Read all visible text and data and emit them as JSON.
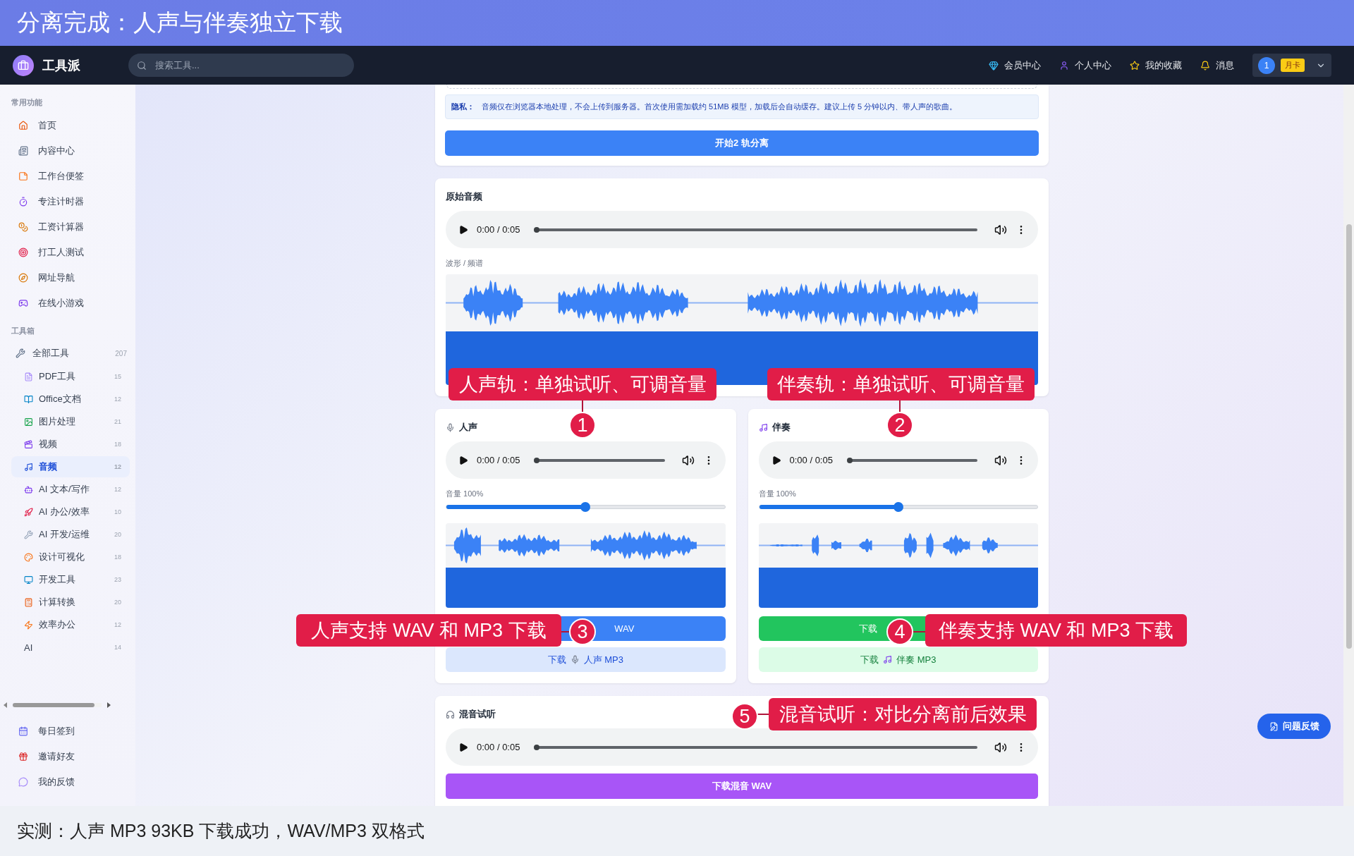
{
  "banner": {
    "title": "分离完成：人声与伴奏独立下载"
  },
  "header": {
    "logo": "工具派",
    "search": {
      "placeholder": "搜索工具..."
    },
    "nav": [
      "会员中心",
      "个人中心",
      "我的收藏",
      "消息"
    ],
    "user": {
      "avatar": "1",
      "badge": "月卡"
    }
  },
  "sidebar": {
    "common": {
      "title": "常用功能",
      "items": [
        {
          "label": "首页"
        },
        {
          "label": "内容中心"
        },
        {
          "label": "工作台便签"
        },
        {
          "label": "专注计时器"
        },
        {
          "label": "工资计算器"
        },
        {
          "label": "打工人测试"
        },
        {
          "label": "网址导航"
        },
        {
          "label": "在线小游戏"
        }
      ]
    },
    "toolbox": {
      "title": "工具箱",
      "all": {
        "label": "全部工具",
        "count": "207"
      },
      "categories": [
        {
          "label": "PDF工具",
          "count": "15",
          "selected": false
        },
        {
          "label": "Office文档",
          "count": "12",
          "selected": false
        },
        {
          "label": "图片处理",
          "count": "21",
          "selected": false
        },
        {
          "label": "视频",
          "count": "18",
          "selected": false
        },
        {
          "label": "音频",
          "count": "12",
          "selected": true
        },
        {
          "label": "AI 文本/写作",
          "count": "12",
          "selected": false
        },
        {
          "label": "AI 办公/效率",
          "count": "10",
          "selected": false
        },
        {
          "label": "AI 开发/运维",
          "count": "20",
          "selected": false
        },
        {
          "label": "设计可视化",
          "count": "18",
          "selected": false
        },
        {
          "label": "开发工具",
          "count": "23",
          "selected": false
        },
        {
          "label": "计算转换",
          "count": "20",
          "selected": false
        },
        {
          "label": "效率办公",
          "count": "12",
          "selected": false
        },
        {
          "label": "AI",
          "count": "14",
          "selected": false
        }
      ]
    },
    "footer_items": [
      "每日签到",
      "邀请好友",
      "我的反馈"
    ]
  },
  "separation": {
    "privacy_label": "隐私：",
    "privacy_text": "音频仅在浏览器本地处理，不会上传到服务器。首次使用需加载约 51MB 模型，加载后会自动缓存。建议上传 5 分钟以内、带人声的歌曲。",
    "start_button": "开始2 轨分离"
  },
  "original": {
    "title": "原始音频",
    "time": "0:00 / 0:05",
    "progress": {
      "level": 0
    },
    "wave_label": "波形 / 频谱"
  },
  "tracks": [
    {
      "kind": "vocal",
      "title": "人声",
      "time": "0:00 / 0:05",
      "progress": {
        "level": 0
      },
      "volume_label": "音量 100%",
      "volume": {
        "level": 0.5
      },
      "wav_button": "WAV",
      "mp3_button": {
        "prefix": "下载",
        "label": "人声 MP3"
      }
    },
    {
      "kind": "accompaniment",
      "title": "伴奏",
      "time": "0:00 / 0:05",
      "progress": {
        "level": 0
      },
      "volume_label": "音量 100%",
      "volume": {
        "level": 0.5
      },
      "wav_button": "下载",
      "mp3_button": {
        "prefix": "下载",
        "label": "伴奏 MP3"
      }
    }
  ],
  "mix": {
    "title": "混音试听",
    "time": "0:00 / 0:05",
    "progress": {
      "level": 0
    },
    "download_button": "下载混音 WAV"
  },
  "annotations": [
    {
      "number": "1",
      "text": "人声轨：单独试听、可调音量"
    },
    {
      "number": "2",
      "text": "伴奏轨：单独试听、可调音量"
    },
    {
      "number": "3",
      "text": "人声支持 WAV 和 MP3 下载"
    },
    {
      "number": "4",
      "text": "伴奏支持 WAV 和 MP3 下载"
    },
    {
      "number": "5",
      "text": "混音试听：对比分离前后效果"
    }
  ],
  "feedback_button": "问题反馈",
  "caption": "实测：人声 MP3 93KB 下载成功，WAV/MP3 双格式"
}
